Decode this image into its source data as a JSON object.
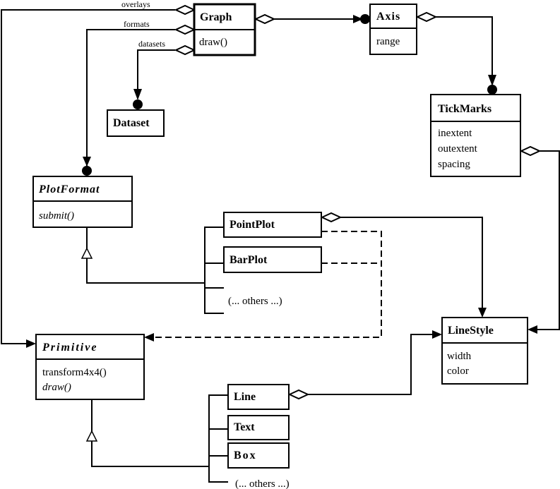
{
  "classes": {
    "graph": {
      "name": "Graph",
      "ops": [
        "draw()"
      ]
    },
    "axis": {
      "name": "Axis",
      "attrs": [
        "range"
      ]
    },
    "dataset": {
      "name": "Dataset"
    },
    "tickmarks": {
      "name": "TickMarks",
      "attrs": [
        "inextent",
        "outextent",
        "spacing"
      ]
    },
    "plotformat": {
      "name": "PlotFormat",
      "ops": [
        "submit()"
      ]
    },
    "pointplot": {
      "name": "PointPlot"
    },
    "barplot": {
      "name": "BarPlot"
    },
    "plot_others": "(... others ...)",
    "primitive": {
      "name": "Primitive",
      "ops": [
        "transform4x4()",
        "draw()"
      ]
    },
    "line": {
      "name": "Line"
    },
    "text": {
      "name": "Text"
    },
    "box": {
      "name": "Box"
    },
    "prim_others": "(... others ...)",
    "linestyle": {
      "name": "LineStyle",
      "attrs": [
        "width",
        "color"
      ]
    }
  },
  "roles": {
    "overlays": "overlays",
    "formats": "formats",
    "datasets": "datasets"
  }
}
